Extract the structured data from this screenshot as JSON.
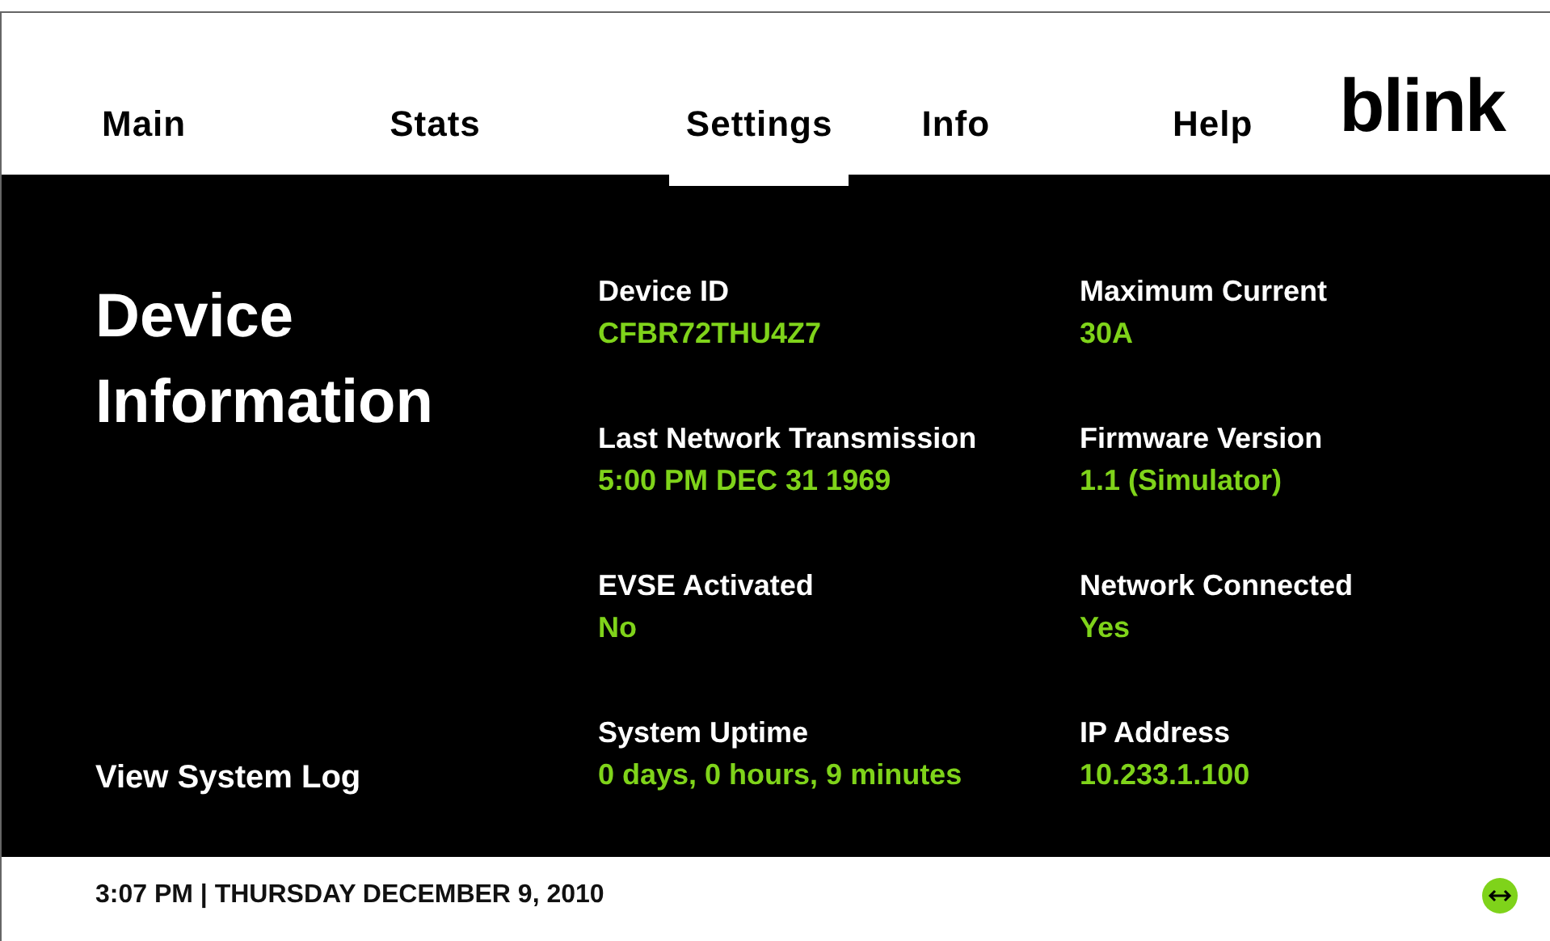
{
  "tabs": [
    {
      "label": "Main",
      "selected": false
    },
    {
      "label": "Stats",
      "selected": false
    },
    {
      "label": "Settings",
      "selected": true
    },
    {
      "label": "Info",
      "selected": false
    },
    {
      "label": "Help",
      "selected": false
    }
  ],
  "logo": "blink",
  "page_title": "Device Information",
  "log_button": "View System Log",
  "fields": [
    {
      "label": "Device ID",
      "value": "CFBR72THU4Z7"
    },
    {
      "label": "Maximum Current",
      "value": "30A"
    },
    {
      "label": "Last Network Transmission",
      "value": "5:00 PM DEC 31 1969"
    },
    {
      "label": "Firmware Version",
      "value": "1.1 (Simulator)"
    },
    {
      "label": "EVSE Activated",
      "value": "No"
    },
    {
      "label": "Network Connected",
      "value": "Yes"
    },
    {
      "label": "System Uptime",
      "value": "0 days, 0 hours, 9 minutes"
    },
    {
      "label": "IP Address",
      "value": "10.233.1.100"
    }
  ],
  "status_bar": {
    "time": "3:07 PM | THURSDAY DECEMBER 9, 2010"
  }
}
